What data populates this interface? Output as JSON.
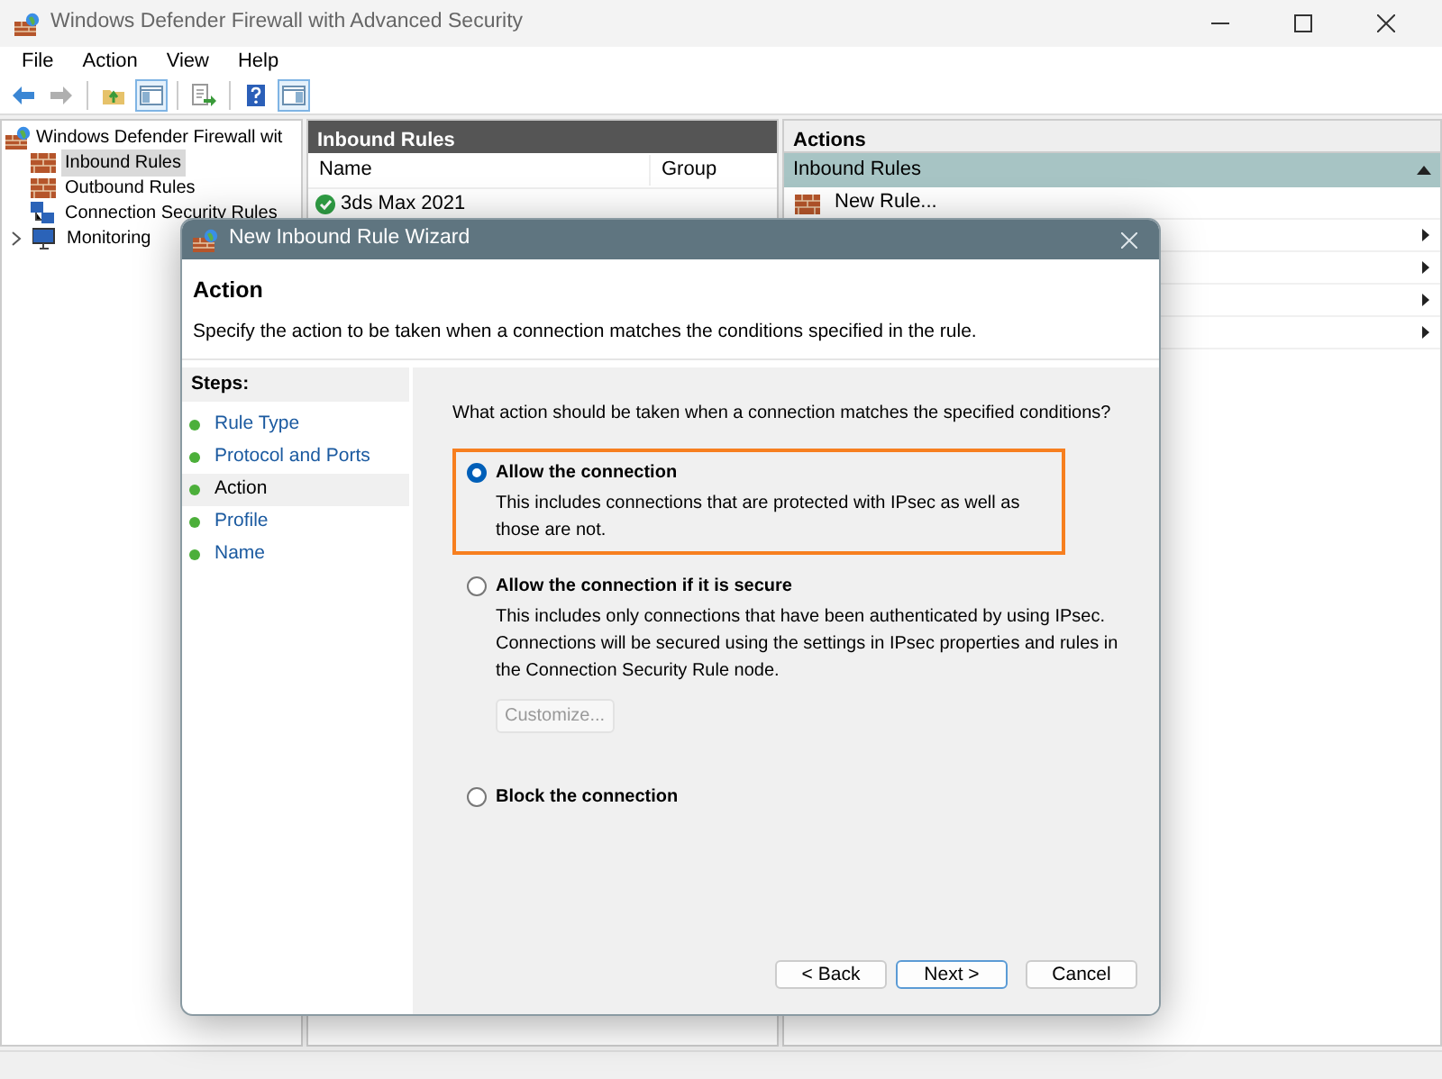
{
  "window": {
    "title": "Windows Defender Firewall with Advanced Security"
  },
  "menu": [
    "File",
    "Action",
    "View",
    "Help"
  ],
  "toolbar": [
    {
      "kind": "back",
      "disabled": false,
      "pressed": false
    },
    {
      "kind": "forward",
      "disabled": true,
      "pressed": false
    },
    {
      "kind": "sep"
    },
    {
      "kind": "up",
      "disabled": false,
      "pressed": false
    },
    {
      "kind": "tree",
      "disabled": false,
      "pressed": true
    },
    {
      "kind": "sep"
    },
    {
      "kind": "export",
      "disabled": false,
      "pressed": false
    },
    {
      "kind": "sep"
    },
    {
      "kind": "help",
      "disabled": false,
      "pressed": false
    },
    {
      "kind": "pane",
      "disabled": false,
      "pressed": true
    }
  ],
  "tree": {
    "label": "Windows Defender Firewall wit",
    "selected": false,
    "children": [
      {
        "label": "Inbound Rules",
        "kind": "inbound",
        "selected": true
      },
      {
        "label": "Outbound Rules",
        "kind": "outbound",
        "selected": false
      },
      {
        "label": "Connection Security Rules",
        "kind": "security",
        "selected": false
      },
      {
        "label": "Monitoring",
        "kind": "monitor",
        "selected": false,
        "expanded": false
      }
    ]
  },
  "rules_pane": {
    "title": "Inbound Rules",
    "columns": [
      "Name",
      "Group"
    ],
    "rows": [
      {
        "name": "3ds Max 2021",
        "enabled": true
      }
    ]
  },
  "actions_pane": {
    "title": "Actions",
    "section": {
      "title": "Inbound Rules",
      "expanded": true
    },
    "items": [
      {
        "kind": "command",
        "label": "New Rule..."
      },
      {
        "kind": "submenu"
      },
      {
        "kind": "submenu"
      },
      {
        "kind": "submenu"
      },
      {
        "kind": "submenu"
      }
    ]
  },
  "dialog": {
    "title": "New Inbound Rule Wizard",
    "heading": "Action",
    "description": "Specify the action to be taken when a connection matches the conditions specified in the rule.",
    "steps_title": "Steps:",
    "steps": [
      {
        "label": "Rule Type",
        "selected": false
      },
      {
        "label": "Protocol and Ports",
        "selected": false
      },
      {
        "label": "Action",
        "selected": true
      },
      {
        "label": "Profile",
        "selected": false
      },
      {
        "label": "Name",
        "selected": false
      }
    ],
    "question": "What action should be taken when a connection matches the specified conditions?",
    "options": [
      {
        "label": "Allow the connection",
        "selected": true,
        "highlighted": true,
        "description": "This includes connections that are protected with IPsec as well as those are not."
      },
      {
        "label": "Allow the connection if it is secure",
        "selected": false,
        "highlighted": false,
        "description": "This includes only connections that have been authenticated by using IPsec.  Connections will be secured using the settings in IPsec properties and rules in the Connection Security Rule node.",
        "button": {
          "label": "Customize...",
          "disabled": true
        }
      },
      {
        "label": "Block the connection",
        "selected": false,
        "highlighted": false
      }
    ],
    "buttons": [
      {
        "label": "< Back",
        "default": false
      },
      {
        "label": "Next >",
        "default": true
      },
      {
        "label": "Cancel",
        "default": false
      }
    ]
  }
}
